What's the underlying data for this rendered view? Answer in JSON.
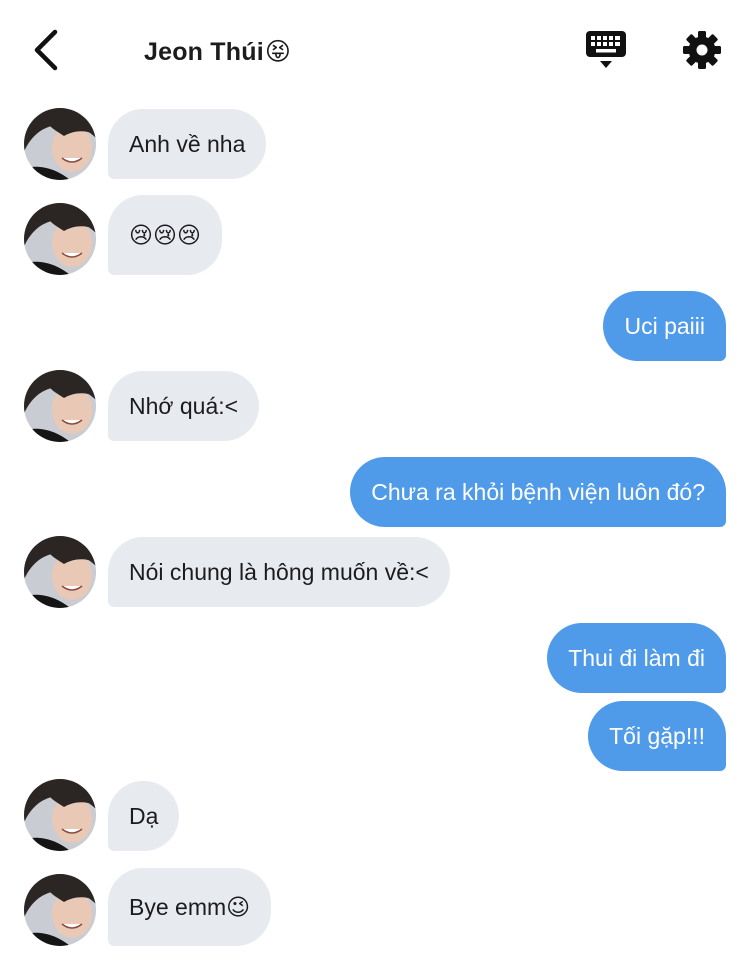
{
  "header": {
    "contact_name": "Jeon Thúi",
    "contact_emoji": "😝"
  },
  "messages": [
    {
      "side": "in",
      "text": "Anh về nha"
    },
    {
      "side": "in",
      "text": "😢😢😢"
    },
    {
      "side": "out",
      "text": "Uci paiii"
    },
    {
      "side": "in",
      "text": "Nhớ quá:<"
    },
    {
      "side": "out",
      "text": "Chưa ra khỏi bệnh viện luôn đó?"
    },
    {
      "side": "in",
      "text": "Nói chung là hông muốn về:<"
    },
    {
      "side": "out",
      "text": "Thui đi làm đi"
    },
    {
      "side": "out",
      "text": "Tối gặp!!!"
    },
    {
      "side": "in",
      "text": "Dạ"
    },
    {
      "side": "in",
      "text": "Bye emm",
      "emoji": "😉"
    }
  ],
  "colors": {
    "incoming_bubble": "#e7ebf0",
    "outgoing_bubble": "#4f9be9",
    "text": "#1c1c1e"
  },
  "icons": {
    "back": "chevron-left-icon",
    "keyboard": "keyboard-icon",
    "settings": "gear-icon"
  }
}
